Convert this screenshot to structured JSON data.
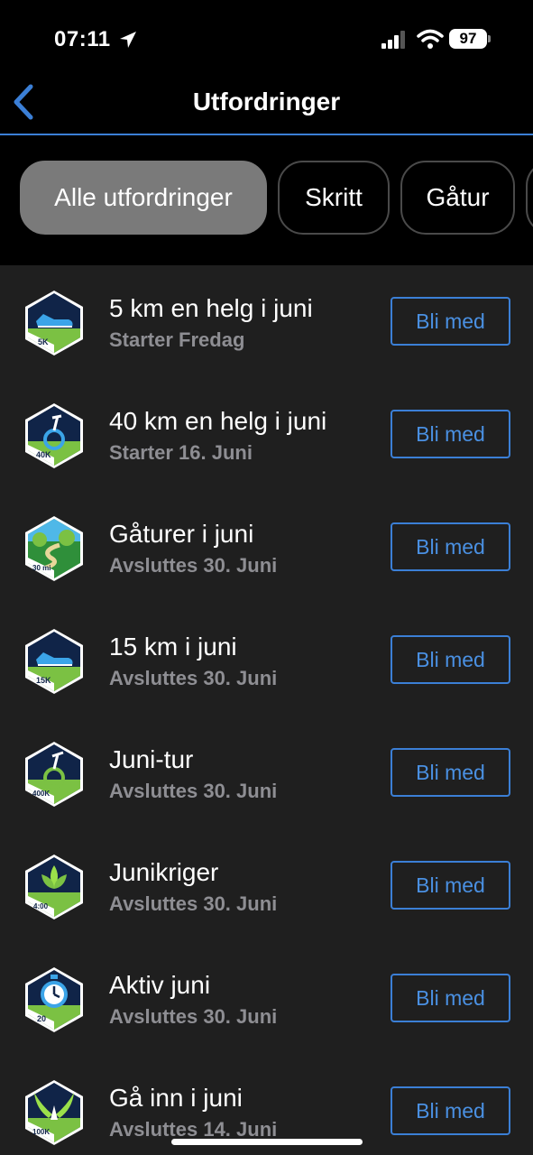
{
  "status_bar": {
    "time": "07:11",
    "battery": "97"
  },
  "nav": {
    "title": "Utfordringer"
  },
  "tabs": [
    {
      "label": "Alle utfordringer",
      "active": true
    },
    {
      "label": "Skritt",
      "active": false
    },
    {
      "label": "Gåtur",
      "active": false
    }
  ],
  "challenges": [
    {
      "name": "5 km en helg i juni",
      "subtitle": "Starter Fredag",
      "button": "Bli med",
      "badge_icon": "running-shoe-icon",
      "badge_label": "5K"
    },
    {
      "name": "40 km en helg i juni",
      "subtitle": "Starter 16. Juni",
      "button": "Bli med",
      "badge_icon": "bicycle-icon",
      "badge_label": "40K"
    },
    {
      "name": "Gåturer i juni",
      "subtitle": "Avsluttes 30. Juni",
      "button": "Bli med",
      "badge_icon": "trees-path-icon",
      "badge_label": "30 mi"
    },
    {
      "name": "15 km i juni",
      "subtitle": "Avsluttes 30. Juni",
      "button": "Bli med",
      "badge_icon": "running-shoe-icon",
      "badge_label": "15K"
    },
    {
      "name": "Juni-tur",
      "subtitle": "Avsluttes 30. Juni",
      "button": "Bli med",
      "badge_icon": "bicycle-icon",
      "badge_label": "400K"
    },
    {
      "name": "Junikriger",
      "subtitle": "Avsluttes 30. Juni",
      "button": "Bli med",
      "badge_icon": "lotus-icon",
      "badge_label": "4:00"
    },
    {
      "name": "Aktiv juni",
      "subtitle": "Avsluttes 30. Juni",
      "button": "Bli med",
      "badge_icon": "stopwatch-icon",
      "badge_label": "20"
    },
    {
      "name": "Gå inn i juni",
      "subtitle": "Avsluttes 14. Juni",
      "button": "Bli med",
      "badge_icon": "wings-icon",
      "badge_label": "100K"
    }
  ],
  "colors": {
    "accent": "#3b7fd6",
    "list_bg": "#1f1f1f",
    "badge_navy": "#102448",
    "badge_green": "#7bc143"
  }
}
